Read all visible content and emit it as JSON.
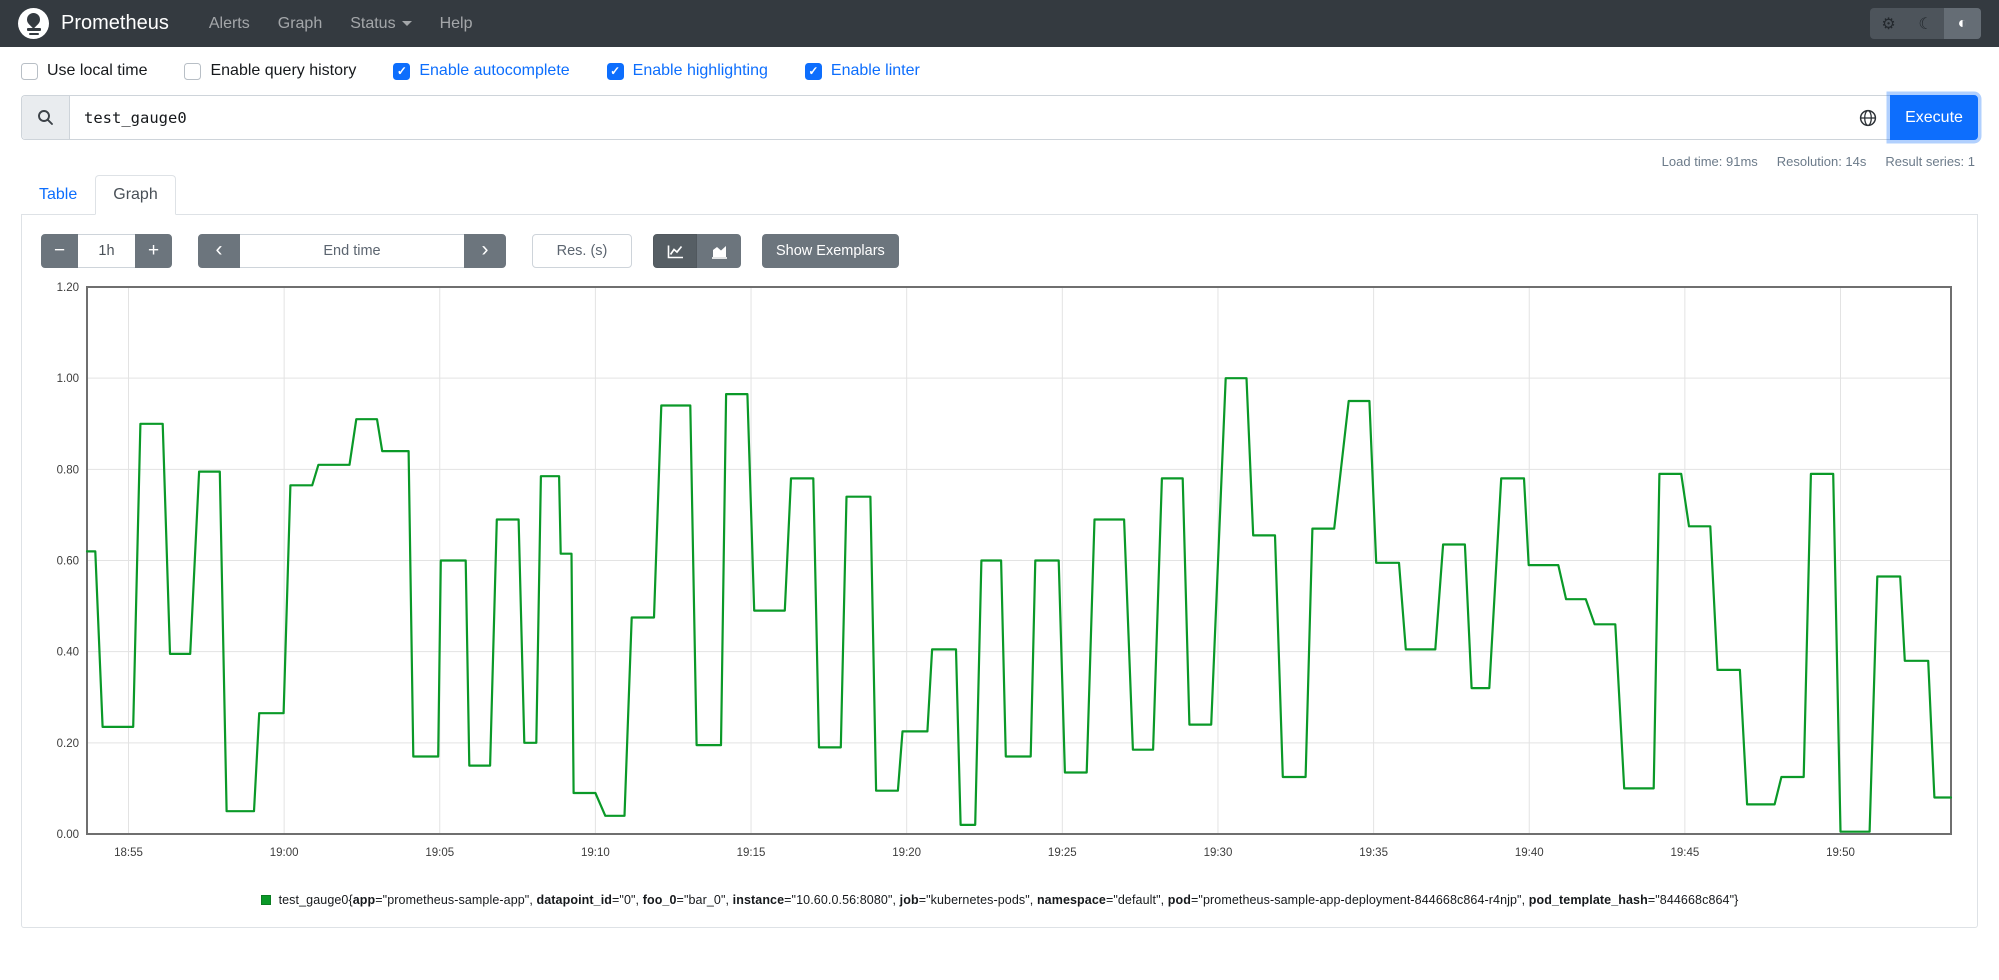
{
  "colors": {
    "navbar_bg": "#343a40",
    "accent_blue": "#0d6efd",
    "button_gray": "#6c757d",
    "line_green": "#0a9928",
    "panel_border": "#dee2e6",
    "grid_line": "#e3e3e3",
    "plot_border": "#6f6f6f",
    "axis_text": "#3d3d3d"
  },
  "icons": {
    "gear": "⚙",
    "moon": "☾",
    "contrast": "◐",
    "minus": "−",
    "plus": "+",
    "chevron_left": "‹",
    "chevron_right": "›",
    "check": "✓",
    "search": "magnifier-svg",
    "globe": "globe-svg",
    "line_chart": "line-chart-svg",
    "stacked_chart": "stacked-chart-svg"
  },
  "navbar": {
    "brand": "Prometheus",
    "items": [
      {
        "label": "Alerts",
        "dropdown": false
      },
      {
        "label": "Graph",
        "dropdown": false
      },
      {
        "label": "Status",
        "dropdown": true
      },
      {
        "label": "Help",
        "dropdown": false
      }
    ]
  },
  "options": {
    "checkboxes": [
      {
        "label": "Use local time",
        "checked": false
      },
      {
        "label": "Enable query history",
        "checked": false
      },
      {
        "label": "Enable autocomplete",
        "checked": true
      },
      {
        "label": "Enable highlighting",
        "checked": true
      },
      {
        "label": "Enable linter",
        "checked": true
      }
    ]
  },
  "query": {
    "value": "test_gauge0",
    "execute_label": "Execute"
  },
  "stats": {
    "load_time": "Load time: 91ms",
    "resolution": "Resolution: 14s",
    "result_series": "Result series: 1"
  },
  "tabs": [
    {
      "label": "Table",
      "active": false
    },
    {
      "label": "Graph",
      "active": true
    }
  ],
  "graph_controls": {
    "range": "1h",
    "end_time_placeholder": "End time",
    "res_placeholder": "Res. (s)",
    "show_exemplars": "Show Exemplars"
  },
  "chart_data": {
    "type": "line",
    "style": "step-gauge-timeseries",
    "title": "",
    "xlabel": "",
    "ylabel": "",
    "x_unit": "seconds since 18:50:00",
    "x_domain": [
      220,
      3813
    ],
    "ylim": [
      0,
      1.2
    ],
    "grid": true,
    "line_color": "#0a9928",
    "y_ticks": [
      {
        "v": 0.0,
        "label": "0.00"
      },
      {
        "v": 0.2,
        "label": "0.20"
      },
      {
        "v": 0.4,
        "label": "0.40"
      },
      {
        "v": 0.6,
        "label": "0.60"
      },
      {
        "v": 0.8,
        "label": "0.80"
      },
      {
        "v": 1.0,
        "label": "1.00"
      },
      {
        "v": 1.2,
        "label": "1.20"
      }
    ],
    "x_ticks": [
      {
        "t": 300,
        "label": "18:55"
      },
      {
        "t": 600,
        "label": "19:00"
      },
      {
        "t": 900,
        "label": "19:05"
      },
      {
        "t": 1200,
        "label": "19:10"
      },
      {
        "t": 1500,
        "label": "19:15"
      },
      {
        "t": 1800,
        "label": "19:20"
      },
      {
        "t": 2100,
        "label": "19:25"
      },
      {
        "t": 2400,
        "label": "19:30"
      },
      {
        "t": 2700,
        "label": "19:35"
      },
      {
        "t": 3000,
        "label": "19:40"
      },
      {
        "t": 3300,
        "label": "19:45"
      },
      {
        "t": 3600,
        "label": "19:50"
      }
    ],
    "series_name": "test_gauge0",
    "segments": [
      [
        220,
        236,
        0.62
      ],
      [
        250,
        309,
        0.235
      ],
      [
        323,
        366,
        0.9
      ],
      [
        380,
        419,
        0.395
      ],
      [
        436,
        476,
        0.795
      ],
      [
        489,
        542,
        0.05
      ],
      [
        552,
        599,
        0.265
      ],
      [
        612,
        654,
        0.765
      ],
      [
        666,
        726,
        0.81
      ],
      [
        739,
        779,
        0.91
      ],
      [
        789,
        840,
        0.84
      ],
      [
        849,
        897,
        0.17
      ],
      [
        902,
        950,
        0.6
      ],
      [
        957,
        997,
        0.15
      ],
      [
        1010,
        1052,
        0.69
      ],
      [
        1063,
        1086,
        0.2
      ],
      [
        1095,
        1130,
        0.785
      ],
      [
        1133,
        1154,
        0.615
      ],
      [
        1158,
        1200,
        0.09
      ],
      [
        1219,
        1256,
        0.04
      ],
      [
        1270,
        1313,
        0.475
      ],
      [
        1327,
        1383,
        0.94
      ],
      [
        1395,
        1442,
        0.195
      ],
      [
        1452,
        1493,
        0.965
      ],
      [
        1506,
        1565,
        0.49
      ],
      [
        1577,
        1620,
        0.78
      ],
      [
        1631,
        1673,
        0.19
      ],
      [
        1684,
        1730,
        0.74
      ],
      [
        1741,
        1783,
        0.095
      ],
      [
        1792,
        1840,
        0.225
      ],
      [
        1849,
        1895,
        0.405
      ],
      [
        1904,
        1932,
        0.02
      ],
      [
        1944,
        1982,
        0.6
      ],
      [
        1991,
        2039,
        0.17
      ],
      [
        2048,
        2093,
        0.6
      ],
      [
        2105,
        2147,
        0.135
      ],
      [
        2162,
        2219,
        0.69
      ],
      [
        2236,
        2275,
        0.185
      ],
      [
        2292,
        2332,
        0.78
      ],
      [
        2345,
        2387,
        0.24
      ],
      [
        2415,
        2455,
        1.0
      ],
      [
        2468,
        2510,
        0.655
      ],
      [
        2525,
        2569,
        0.125
      ],
      [
        2582,
        2624,
        0.67
      ],
      [
        2652,
        2692,
        0.95
      ],
      [
        2705,
        2749,
        0.595
      ],
      [
        2762,
        2819,
        0.405
      ],
      [
        2834,
        2876,
        0.635
      ],
      [
        2889,
        2923,
        0.32
      ],
      [
        2946,
        2990,
        0.78
      ],
      [
        2999,
        3056,
        0.59
      ],
      [
        3071,
        3109,
        0.515
      ],
      [
        3126,
        3166,
        0.46
      ],
      [
        3183,
        3240,
        0.1
      ],
      [
        3251,
        3293,
        0.79
      ],
      [
        3308,
        3349,
        0.675
      ],
      [
        3363,
        3406,
        0.36
      ],
      [
        3420,
        3473,
        0.065
      ],
      [
        3486,
        3529,
        0.125
      ],
      [
        3543,
        3586,
        0.79
      ],
      [
        3600,
        3656,
        0.005
      ],
      [
        3671,
        3715,
        0.565
      ],
      [
        3724,
        3769,
        0.38
      ],
      [
        3781,
        3813,
        0.08
      ]
    ]
  },
  "legend": {
    "metric": "test_gauge0",
    "labels": [
      [
        "app",
        "prometheus-sample-app"
      ],
      [
        "datapoint_id",
        "0"
      ],
      [
        "foo_0",
        "bar_0"
      ],
      [
        "instance",
        "10.60.0.56:8080"
      ],
      [
        "job",
        "kubernetes-pods"
      ],
      [
        "namespace",
        "default"
      ],
      [
        "pod",
        "prometheus-sample-app-deployment-844668c864-r4njp"
      ],
      [
        "pod_template_hash",
        "844668c864"
      ]
    ]
  }
}
